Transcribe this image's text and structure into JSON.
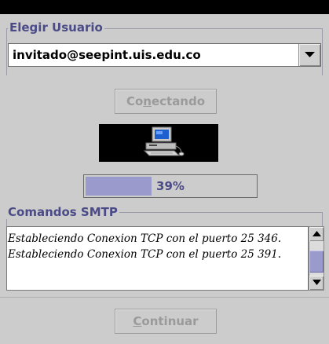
{
  "user_group": {
    "legend": "Elegir Usuario",
    "selected_user": "invitado@seepint.uis.edu.co"
  },
  "connect_button": {
    "label_before": "Co",
    "label_mnemonic": "n",
    "label_after": "ectando",
    "enabled": false
  },
  "progress": {
    "value_percent": 39,
    "text": "39%"
  },
  "smtp_group": {
    "legend": "Comandos SMTP",
    "log_lines": [
      "Estableciendo Conexion TCP con el puerto 25 346.",
      "Estableciendo Conexion TCP con el puerto 25 391."
    ]
  },
  "continue_button": {
    "label_mnemonic": "C",
    "label_after": "ontinuar",
    "enabled": false
  },
  "colors": {
    "background": "#cccccc",
    "accent": "#9a9acc",
    "legend_text": "#4b4b88",
    "monitor_bg": "#000000"
  },
  "icons": [
    "computer-icon",
    "chevron-down-icon",
    "scroll-up-icon",
    "scroll-down-icon"
  ]
}
